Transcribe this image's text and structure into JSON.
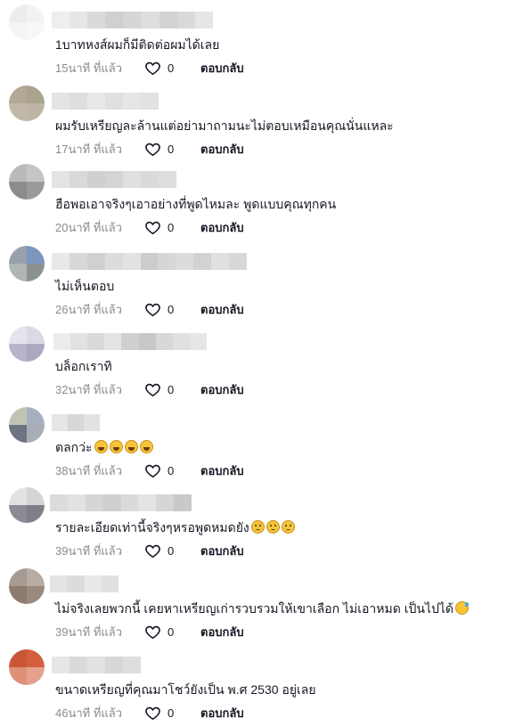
{
  "colors": {
    "text": "#161823",
    "meta": "#8a8b91",
    "background": "#ffffff"
  },
  "comments": [
    {
      "text": "1บาทหงส์ผมก็มีติดต่อผมได้เลย",
      "time": "15นาที ที่แล้ว",
      "likes": "0",
      "reply": "ตอบกลับ",
      "emoji": [],
      "avatar": [
        "#ececec",
        "#f2f2f2",
        "#f4f4f4",
        "#f7f7f7"
      ],
      "uname": [
        "#eeeeee",
        "#e6e6e6",
        "#dadada",
        "#d0d0d0",
        "#d6d6d6",
        "#dedede",
        "#d2d2d2",
        "#d9d9d9",
        "#e6e6e6"
      ]
    },
    {
      "text": "ผมรับเหรียญละล้านแต่อย่ามาถามนะไม่ตอบเหมือนคุณนั่นแหละ",
      "time": "17นาที ที่แล้ว",
      "likes": "0",
      "reply": "ตอบกลับ",
      "emoji": [],
      "avatar": [
        "#b3a796",
        "#a8a48d",
        "#c1b8a8",
        "#bdb6a4"
      ],
      "uname": [
        "#e4e4e4",
        "#dedede",
        "#e8e8e8",
        "#e0e0e0",
        "#e6e6e6",
        "#e2e2e2"
      ]
    },
    {
      "text": "ฮือพอเอาจริงๆเอาอย่างที่พูดไหมละ พูดแบบคุณทุกคน",
      "time": "20นาที ที่แล้ว",
      "likes": "0",
      "reply": "ตอบกลับ",
      "emoji": [],
      "avatar": [
        "#b9b9b9",
        "#c5c5c5",
        "#8c8c8c",
        "#9a9a9a"
      ],
      "uname": [
        "#e3e3e3",
        "#d9d9d9",
        "#cfcfcf",
        "#d4d4d4",
        "#e0e0e0",
        "#dadada",
        "#dedede"
      ]
    },
    {
      "text": "ไม่เห็นตอบ",
      "time": "26นาที ที่แล้ว",
      "likes": "0",
      "reply": "ตอบกลับ",
      "emoji": [],
      "avatar": [
        "#99a0ac",
        "#7c96c0",
        "#b0b6b1",
        "#8a9190"
      ],
      "uname": [
        "#e8e8e8",
        "#d8d8d8",
        "#d0d0d0",
        "#dcdcdc",
        "#e2e2e2",
        "#cccccc",
        "#d6d6d6",
        "#dcdcdc",
        "#d2d2d2",
        "#e0e0e0",
        "#d8d8d8"
      ]
    },
    {
      "text": "บล็อกเราทิ",
      "time": "32นาที ที่แล้ว",
      "likes": "0",
      "reply": "ตอบกลับ",
      "emoji": [],
      "avatar": [
        "#e4e4ec",
        "#dcd8e6",
        "#b5b4c9",
        "#aba8c0"
      ],
      "uname": [
        "#ececec",
        "#e2e2e2",
        "#dadada",
        "#e4e4e4",
        "#cfcfcf",
        "#c8c8c8",
        "#d8d8d8",
        "#e0e0e0",
        "#e6e6e6"
      ]
    },
    {
      "text": "ตลกว่ะ",
      "time": "38นาที ที่แล้ว",
      "likes": "0",
      "reply": "ตอบกลับ",
      "emoji": [
        "laugh",
        "laugh",
        "laugh",
        "laugh"
      ],
      "avatar": [
        "#c1c3b3",
        "#a8b0bf",
        "#6e7384",
        "#a9aeb6"
      ],
      "uname": [
        "#e6e6e6",
        "#d8d8d8",
        "#e2e2e2"
      ]
    },
    {
      "text": "รายละเอียดเท่านี้จริงๆหรอพูดหมดยัง",
      "time": "39นาที ที่แล้ว",
      "likes": "0",
      "reply": "ตอบกลับ",
      "emoji": [
        "sad",
        "sad",
        "sad"
      ],
      "avatar": [
        "#e2e2e2",
        "#d4d4d4",
        "#8b8b95",
        "#7e7f88"
      ],
      "uname": [
        "#dcdcdc",
        "#e2e2e2",
        "#d6d6d6",
        "#cfcfcf",
        "#dadada",
        "#e4e4e4",
        "#d6d6d6",
        "#c9c9c9"
      ]
    },
    {
      "text": "ไม่จริงเลยพวกนี้ เคยหาเหรียญเก่ารวบรวมให้เขาเลือก ไม่เอาหมด เป็นไปได้",
      "time": "39นาที ที่แล้ว",
      "likes": "0",
      "reply": "ตอบกลับ",
      "emoji": [
        "sweat"
      ],
      "avatar": [
        "#a69b92",
        "#b8aca2",
        "#8c7b6e",
        "#9a8a7e"
      ],
      "uname": [
        "#e4e4e4",
        "#dcdcdc",
        "#e8e8e8",
        "#e0e0e0"
      ]
    },
    {
      "text": "ขนาดเหรียญที่คุณมาโชว์ยังเป็น พ.ศ 2530 อยู่เลย",
      "time": "46นาที ที่แล้ว",
      "likes": "0",
      "reply": "ตอบกลับ",
      "emoji": [],
      "avatar": [
        "#c95638",
        "#d35f3c",
        "#e08f78",
        "#e4a18d"
      ],
      "uname": [
        "#e6e6e6",
        "#dadada",
        "#e2e2e2",
        "#d8d8d8",
        "#dedede"
      ]
    }
  ]
}
